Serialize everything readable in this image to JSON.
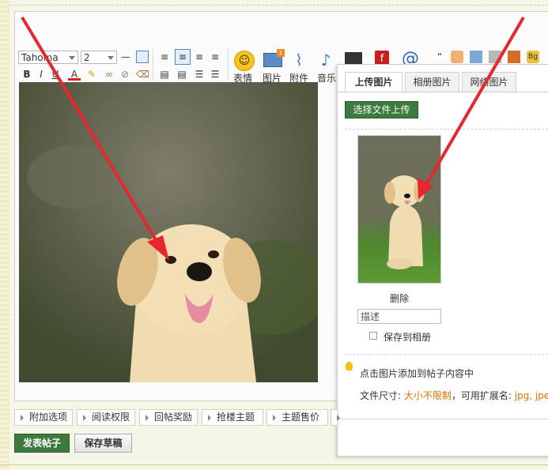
{
  "toolbar": {
    "font": "Tahoma",
    "size": "2",
    "groups": [
      {
        "label": "表情",
        "icon": "smiley-icon"
      },
      {
        "label": "图片",
        "icon": "image-icon"
      },
      {
        "label": "附件",
        "icon": "paperclip-icon"
      },
      {
        "label": "音乐",
        "icon": "music-note-icon"
      }
    ]
  },
  "panel": {
    "tabs": [
      "上传图片",
      "相册图片",
      "网络图片"
    ],
    "upload_button": "选择文件上传",
    "delete_label": "删除",
    "desc_placeholder": "描述",
    "save_album_label": "保存到相册",
    "hint": "点击图片添加到帖子内容中",
    "file_size_label": "文件尺寸:",
    "file_size_value": "大小不限制",
    "ext_label": "，可用扩展名:",
    "ext_value": "jpg, jpe"
  },
  "bottom_options": [
    "附加选项",
    "阅读权限",
    "回帖奖励",
    "抢楼主题",
    "主题售价"
  ],
  "actions": {
    "publish": "发表帖子",
    "save_draft": "保存草稿"
  },
  "colors": {
    "arrow": "#e8262f",
    "publish_bg": "#3d7a3d",
    "highlight": "#e07000"
  }
}
